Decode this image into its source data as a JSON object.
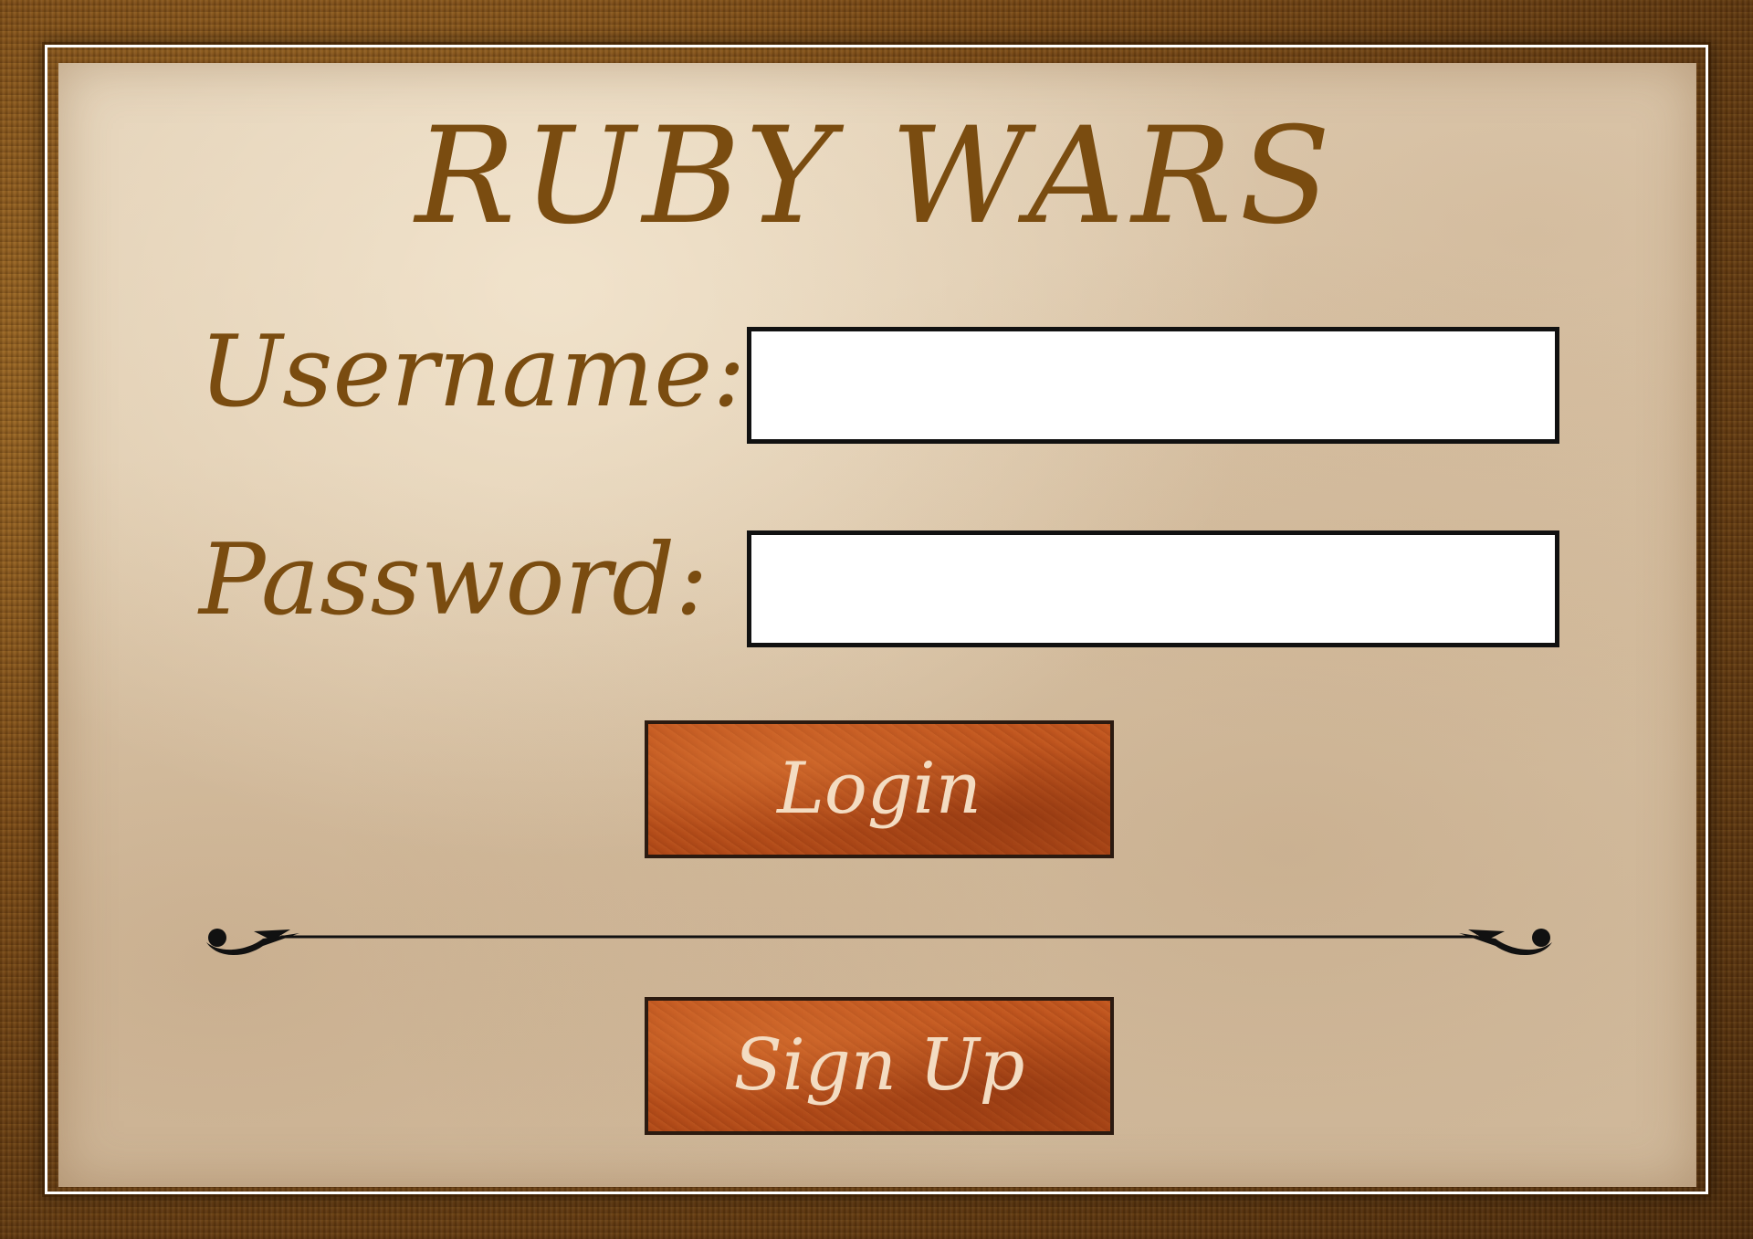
{
  "title": "RUBY  WARS",
  "form": {
    "username_label": "Username:",
    "username_value": "",
    "password_label": "Password:",
    "password_value": ""
  },
  "buttons": {
    "login_label": "Login",
    "signup_label": "Sign Up"
  },
  "colors": {
    "title_text": "#7a4c10",
    "button_fill": "#b84f1b",
    "button_text": "#f3dcc2",
    "parchment": "#dcc7aa",
    "frame": "#7a4a16"
  }
}
